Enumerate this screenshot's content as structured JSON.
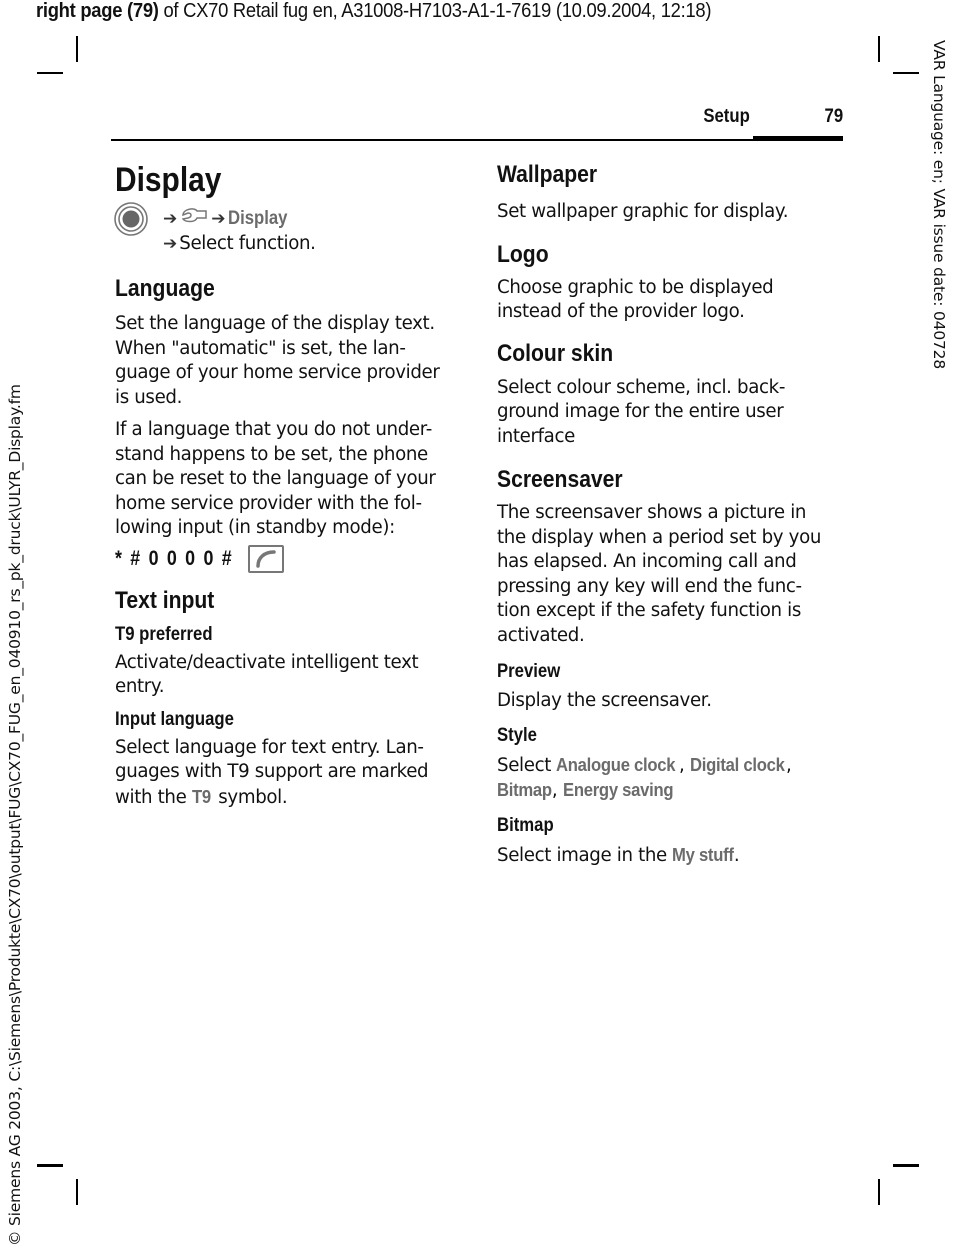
{
  "print_header": {
    "bold_part": "right page (79)",
    "rest": " of CX70 Retail fug en, A31008-H7103-A1-1-7619 (10.09.2004, 12:18)"
  },
  "side_left_text": "© Siemens AG 2003, C:\\Siemens\\Produkte\\CX70\\output\\FUG\\CX70_FUG_en_040910_rs_pk_druck\\ULYR_Display.fm",
  "side_right_text": "VAR Language: en; VAR issue date: 040728",
  "running_head": {
    "section": "Setup",
    "page": "79"
  },
  "title": "Display",
  "navigation": {
    "icons": [
      "nav-key-icon",
      "arrow-icon",
      "wrench-icon",
      "arrow-icon"
    ],
    "path_item": "Display",
    "arrow_glyph": "➔",
    "step2": "Select function."
  },
  "left_column": {
    "language": {
      "heading": "Language",
      "para1": [
        "Set the language of the display text.",
        "When \"automatic\" is set, the lan-",
        "guage of your home service provider",
        "is used."
      ],
      "para2": [
        "If a language that you do not under-",
        "stand happens to be set, the phone",
        "can be reset to the language of your",
        "home service provider with the fol-",
        "lowing input (in standby mode):"
      ],
      "code": "* # 0 0 0 0 #",
      "code_key_icon": "call-key-icon"
    },
    "text_input": {
      "heading": "Text input",
      "t9_heading": "T9 preferred",
      "t9_text": [
        "Activate/deactivate intelligent text",
        "entry."
      ],
      "input_lang_heading": "Input language",
      "input_lang_text": [
        "Select language for text entry. Lan-",
        "guages with T9 support are marked"
      ],
      "input_lang_last": {
        "before": "with the ",
        "highlight": "T9",
        "after": " symbol."
      }
    }
  },
  "right_column": {
    "wallpaper": {
      "heading": "Wallpaper",
      "text": [
        "Set wallpaper graphic for display."
      ]
    },
    "logo": {
      "heading": "Logo",
      "text": [
        "Choose graphic to be displayed",
        "instead of the provider logo."
      ]
    },
    "colour_skin": {
      "heading": "Colour skin",
      "text": [
        "Select colour scheme, incl. back-",
        "ground image for the entire user",
        "interface"
      ]
    },
    "screensaver": {
      "heading": "Screensaver",
      "text": [
        "The screensaver shows a picture in",
        "the display when a period set by you",
        "has elapsed. An incoming call and",
        "pressing any key will end the func-",
        "tion except if the safety function is",
        "activated."
      ],
      "preview_heading": "Preview",
      "preview_text": "Display the screensaver.",
      "style_heading": "Style",
      "style_line1": {
        "before": "Select ",
        "opt1": "Analogue clock",
        "sep1": ", ",
        "opt2": "Digital clock",
        "sep2": ","
      },
      "style_line2": {
        "opt3": "Bitmap",
        "sep": ", ",
        "opt4": "Energy saving"
      },
      "bitmap_heading": "Bitmap",
      "bitmap_text": {
        "before": "Select image in the ",
        "highlight": "My stuff",
        "after": "."
      }
    }
  },
  "colors": {
    "highlight_gray": "#6b6b6b",
    "text": "#111111"
  }
}
